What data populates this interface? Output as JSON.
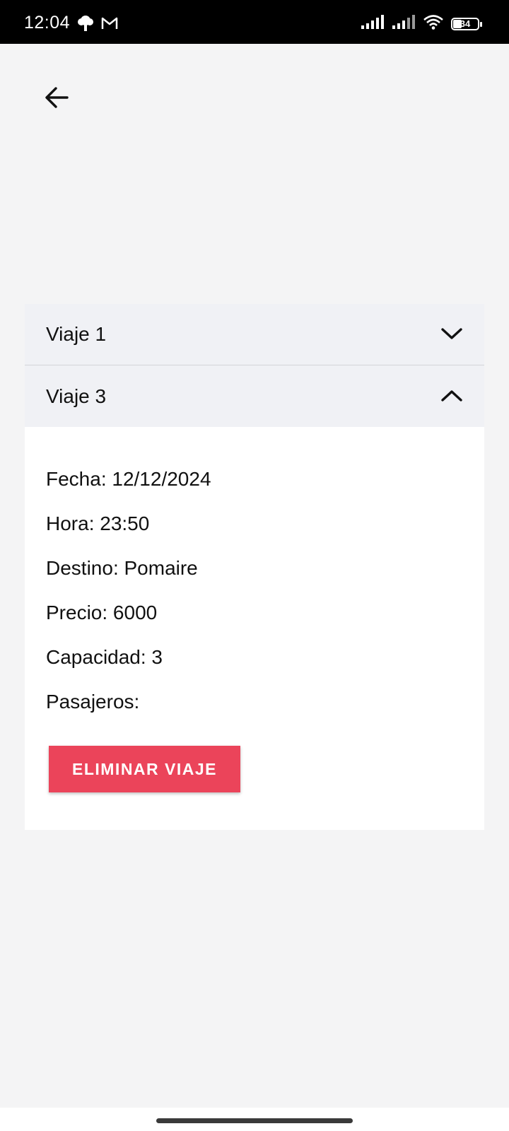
{
  "status_bar": {
    "time": "12:04",
    "battery_level": "34",
    "icons": [
      "tree-icon",
      "gmail-icon",
      "signal-icon",
      "signal-icon",
      "wifi-icon",
      "battery-icon"
    ]
  },
  "nav": {
    "back_icon": "arrow-left-icon"
  },
  "accordion": {
    "items": [
      {
        "label": "Viaje 1",
        "expanded": false,
        "icon": "chevron-down-icon"
      },
      {
        "label": "Viaje 3",
        "expanded": true,
        "icon": "chevron-up-icon"
      }
    ],
    "details": {
      "fecha": "Fecha: 12/12/2024",
      "hora": "Hora: 23:50",
      "destino": "Destino: Pomaire",
      "precio": "Precio: 6000",
      "capacidad": "Capacidad: 3",
      "pasajeros": "Pasajeros:"
    },
    "delete_label": "ELIMINAR VIAJE"
  },
  "colors": {
    "accent_danger": "#eb445a",
    "header_bg": "#f0f1f5",
    "page_bg": "#f4f4f5"
  }
}
